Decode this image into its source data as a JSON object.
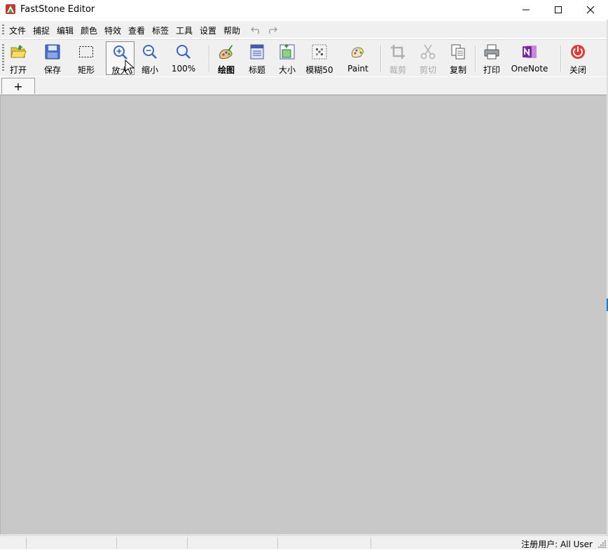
{
  "window": {
    "title": "FastStone Editor",
    "accent_color": "#1979ca"
  },
  "menu": {
    "items": [
      "文件",
      "捕捉",
      "编辑",
      "颜色",
      "特效",
      "查看",
      "标签",
      "工具",
      "设置",
      "帮助"
    ]
  },
  "toolbar": {
    "open": "打开",
    "save": "保存",
    "rect": "矩形",
    "zoom_in": "放大",
    "zoom_out": "缩小",
    "zoom_100": "100%",
    "draw": "绘图",
    "caption": "标题",
    "resize": "大小",
    "blur": "模糊50",
    "paint": "Paint",
    "crop": "裁剪",
    "cut": "剪切",
    "copy": "复制",
    "print": "打印",
    "onenote": "OneNote",
    "close": "关闭"
  },
  "tabs": {
    "add_label": "+"
  },
  "status": {
    "registered_user": "注册用户: All User"
  },
  "canvas": {
    "background": "#c8c8c8"
  }
}
